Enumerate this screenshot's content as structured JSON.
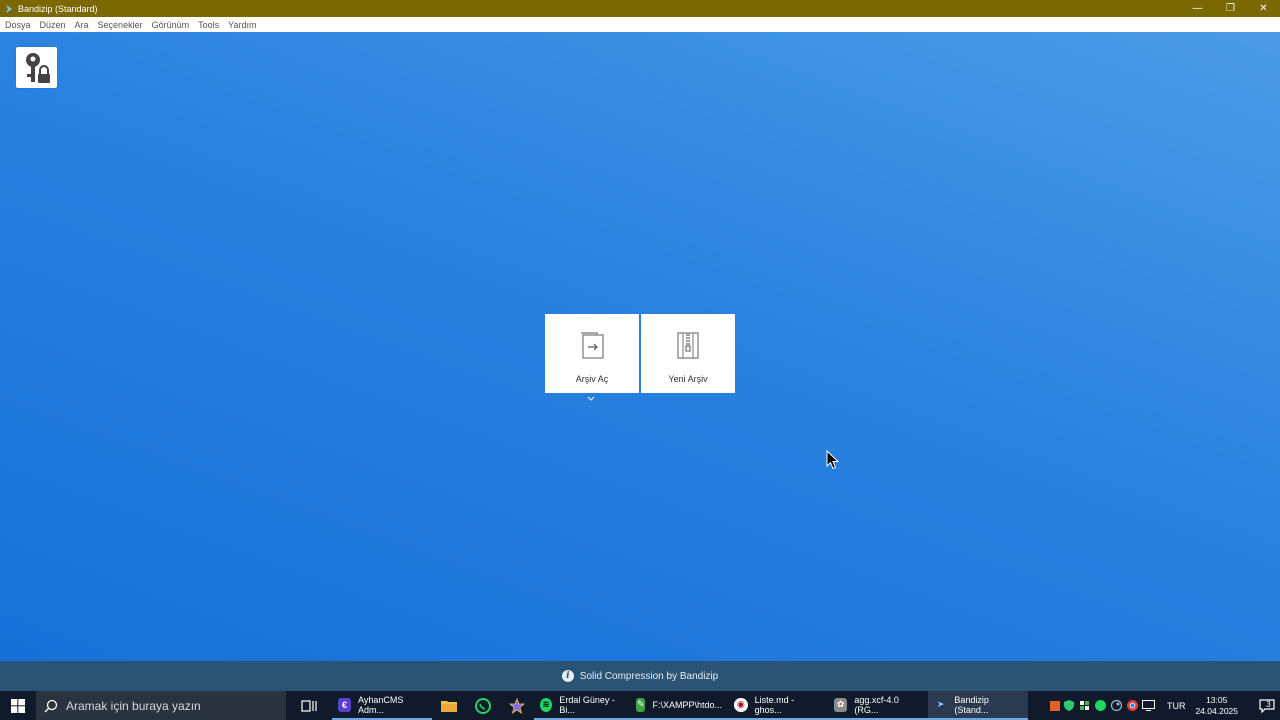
{
  "window": {
    "title": "Bandizip (Standard)",
    "minimize": "—",
    "maximize": "❐",
    "close": "✕"
  },
  "menu": [
    "Dosya",
    "Düzen",
    "Ara",
    "Seçenekler",
    "Görünüm",
    "Tools",
    "Yardım"
  ],
  "actions": {
    "open_label": "Arşiv Aç",
    "new_label": "Yeni Arşiv"
  },
  "footer": {
    "text": "Solid Compression by Bandizip"
  },
  "taskbar": {
    "search_placeholder": "Aramak için buraya yazın",
    "apps": [
      {
        "label": "AyhanCMS Adm...",
        "color": "#5b3fd1",
        "glyph": "€"
      },
      {
        "label": "Erdal Güney - Bi...",
        "color": "#1ed760",
        "glyph": "≋"
      },
      {
        "label": "F:\\XAMPP\\htdo...",
        "color": "#3fa343",
        "glyph": "✎"
      },
      {
        "label": "Liste.md - ghos...",
        "color": "#ffffff",
        "glyph": "◉"
      },
      {
        "label": "agg.xcf-4.0 (RG...",
        "color": "#8a8a8a",
        "glyph": "✿"
      },
      {
        "label": "Bandizip (Stand...",
        "color": "#2b3a51",
        "glyph": "➤"
      }
    ],
    "language": "TUR",
    "time": "13:05",
    "date": "24.04.2025",
    "notification_count": "3"
  },
  "colors": {
    "titlebar": "#7a6800",
    "client_top": "#4b9be6",
    "client_bottom": "#1670d7",
    "footer": "#2a5374",
    "taskbar": "#101a2a"
  }
}
